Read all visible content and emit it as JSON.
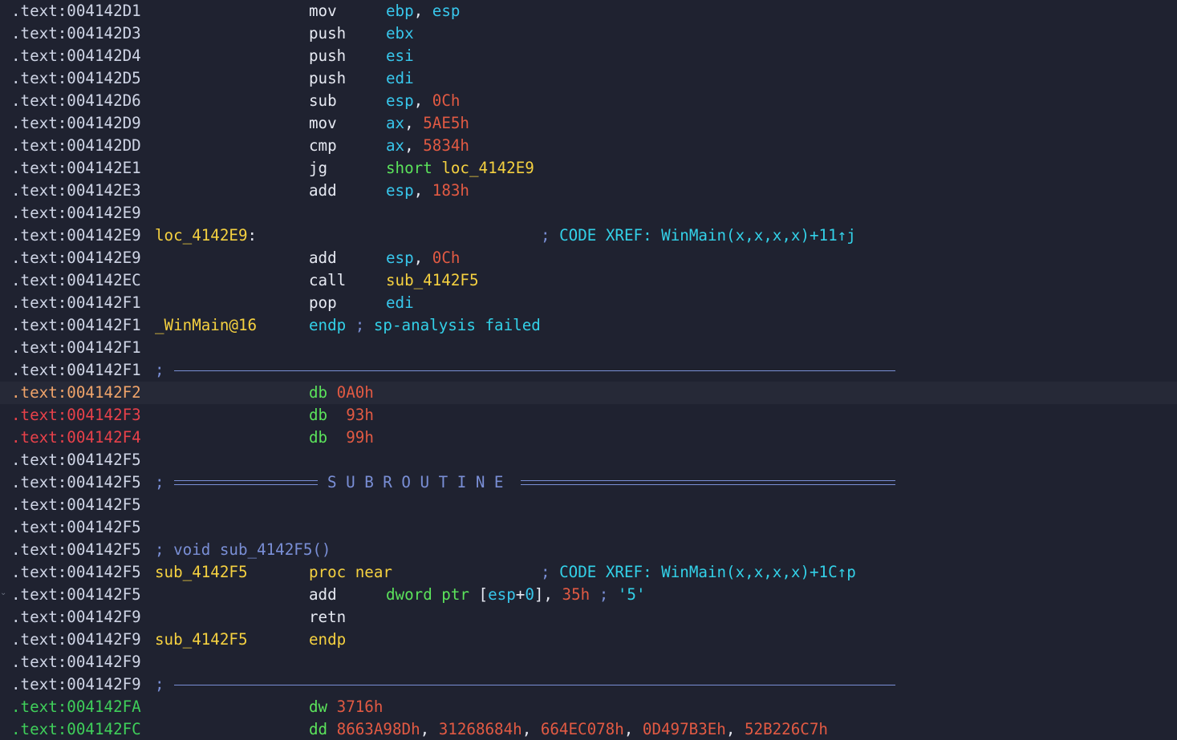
{
  "colors": {
    "background": "#1f2230",
    "highlight_row": "#262937",
    "address": "#cfd5e6",
    "address_orange": "#f0a46a",
    "address_red": "#e8414a",
    "address_green": "#3fcf5a",
    "mnemonic": "#e6e9f2",
    "register": "#38c7ec",
    "number": "#e25a43",
    "label": "#f5d140",
    "keyword_green": "#5be35b",
    "comment": "#7a8fd6",
    "xref_text": "#33d1e8",
    "separator": "#7a8fd6"
  },
  "icons": {
    "fold": "chevron-down-icon"
  },
  "subroutine_label": "S U B R O U T I N E",
  "semicolon": ";",
  "lines": [
    {
      "addr": ".text:004142D1",
      "mn": "mov",
      "op": [
        {
          "t": "ebp",
          "c": "register"
        },
        {
          "t": ", ",
          "c": "mnemonic"
        },
        {
          "t": "esp",
          "c": "register"
        }
      ]
    },
    {
      "addr": ".text:004142D3",
      "mn": "push",
      "op": [
        {
          "t": "ebx",
          "c": "register"
        }
      ]
    },
    {
      "addr": ".text:004142D4",
      "mn": "push",
      "op": [
        {
          "t": "esi",
          "c": "register"
        }
      ]
    },
    {
      "addr": ".text:004142D5",
      "mn": "push",
      "op": [
        {
          "t": "edi",
          "c": "register"
        }
      ]
    },
    {
      "addr": ".text:004142D6",
      "mn": "sub",
      "op": [
        {
          "t": "esp",
          "c": "register"
        },
        {
          "t": ", ",
          "c": "mnemonic"
        },
        {
          "t": "0Ch",
          "c": "number"
        }
      ]
    },
    {
      "addr": ".text:004142D9",
      "mn": "mov",
      "op": [
        {
          "t": "ax",
          "c": "register"
        },
        {
          "t": ", ",
          "c": "mnemonic"
        },
        {
          "t": "5AE5h",
          "c": "number"
        }
      ]
    },
    {
      "addr": ".text:004142DD",
      "mn": "cmp",
      "op": [
        {
          "t": "ax",
          "c": "register"
        },
        {
          "t": ", ",
          "c": "mnemonic"
        },
        {
          "t": "5834h",
          "c": "number"
        }
      ]
    },
    {
      "addr": ".text:004142E1",
      "mn": "jg",
      "op": [
        {
          "t": "short ",
          "c": "keyword_green"
        },
        {
          "t": "loc_4142E9",
          "c": "label"
        }
      ]
    },
    {
      "addr": ".text:004142E3",
      "mn": "add",
      "op": [
        {
          "t": "esp",
          "c": "register"
        },
        {
          "t": ", ",
          "c": "mnemonic"
        },
        {
          "t": "183h",
          "c": "number"
        }
      ]
    },
    {
      "addr": ".text:004142E9"
    },
    {
      "addr": ".text:004142E9",
      "name": [
        {
          "t": "loc_4142E9",
          "c": "label"
        },
        {
          "t": ":",
          "c": "mnemonic"
        }
      ],
      "xref": [
        {
          "t": "; ",
          "c": "comment"
        },
        {
          "t": "CODE XREF: WinMain(x,x,x,x)+11↑j",
          "c": "xref_text"
        }
      ]
    },
    {
      "addr": ".text:004142E9",
      "mn": "add",
      "op": [
        {
          "t": "esp",
          "c": "register"
        },
        {
          "t": ", ",
          "c": "mnemonic"
        },
        {
          "t": "0Ch",
          "c": "number"
        }
      ]
    },
    {
      "addr": ".text:004142EC",
      "mn": "call",
      "op": [
        {
          "t": "sub_4142F5",
          "c": "label"
        }
      ]
    },
    {
      "addr": ".text:004142F1",
      "mn": "pop",
      "op": [
        {
          "t": "edi",
          "c": "register"
        }
      ]
    },
    {
      "addr": ".text:004142F1",
      "name": [
        {
          "t": "_WinMain@16",
          "c": "label"
        }
      ],
      "mn_rich": [
        {
          "t": "endp ",
          "c": "xref_text"
        },
        {
          "t": "; ",
          "c": "comment"
        },
        {
          "t": "sp-analysis failed",
          "c": "xref_text"
        }
      ]
    },
    {
      "addr": ".text:004142F1"
    },
    {
      "addr": ".text:004142F1",
      "sep": "single"
    },
    {
      "addr": ".text:004142F2",
      "addr_c": "orange",
      "hl": true,
      "mn_rich": [
        {
          "t": "db ",
          "c": "keyword_green"
        },
        {
          "t": "0A0h",
          "c": "number"
        }
      ]
    },
    {
      "addr": ".text:004142F3",
      "addr_c": "red",
      "mn_rich": [
        {
          "t": "db  ",
          "c": "keyword_green"
        },
        {
          "t": "93h",
          "c": "number"
        }
      ]
    },
    {
      "addr": ".text:004142F4",
      "addr_c": "red",
      "mn_rich": [
        {
          "t": "db  ",
          "c": "keyword_green"
        },
        {
          "t": "99h",
          "c": "number"
        }
      ]
    },
    {
      "addr": ".text:004142F5"
    },
    {
      "addr": ".text:004142F5",
      "sep": "subroutine"
    },
    {
      "addr": ".text:004142F5"
    },
    {
      "addr": ".text:004142F5"
    },
    {
      "addr": ".text:004142F5",
      "name": [
        {
          "t": "; void sub_4142F5()",
          "c": "comment"
        }
      ]
    },
    {
      "addr": ".text:004142F5",
      "name": [
        {
          "t": "sub_4142F5",
          "c": "label"
        }
      ],
      "mn_rich": [
        {
          "t": "proc near",
          "c": "label"
        }
      ],
      "xref": [
        {
          "t": "; ",
          "c": "comment"
        },
        {
          "t": "CODE XREF: WinMain(x,x,x,x)+1C↑p",
          "c": "xref_text"
        }
      ]
    },
    {
      "addr": ".text:004142F5",
      "mn": "add",
      "op": [
        {
          "t": "dword ptr ",
          "c": "keyword_green"
        },
        {
          "t": "[",
          "c": "mnemonic"
        },
        {
          "t": "esp",
          "c": "register"
        },
        {
          "t": "+",
          "c": "mnemonic"
        },
        {
          "t": "0",
          "c": "register"
        },
        {
          "t": "], ",
          "c": "mnemonic"
        },
        {
          "t": "35h",
          "c": "number"
        },
        {
          "t": " ; ",
          "c": "comment"
        },
        {
          "t": "'5'",
          "c": "xref_text"
        }
      ]
    },
    {
      "addr": ".text:004142F9",
      "mn": "retn"
    },
    {
      "addr": ".text:004142F9",
      "name": [
        {
          "t": "sub_4142F5",
          "c": "label"
        }
      ],
      "mn_rich": [
        {
          "t": "endp",
          "c": "label"
        }
      ]
    },
    {
      "addr": ".text:004142F9"
    },
    {
      "addr": ".text:004142F9",
      "sep": "single"
    },
    {
      "addr": ".text:004142FA",
      "addr_c": "green",
      "mn_rich": [
        {
          "t": "dw ",
          "c": "keyword_green"
        },
        {
          "t": "3716h",
          "c": "number"
        }
      ]
    },
    {
      "addr": ".text:004142FC",
      "addr_c": "green",
      "mn_rich": [
        {
          "t": "dd ",
          "c": "keyword_green"
        },
        {
          "t": "8663A98Dh",
          "c": "number"
        },
        {
          "t": ", ",
          "c": "mnemonic"
        },
        {
          "t": "31268684h",
          "c": "number"
        },
        {
          "t": ", ",
          "c": "mnemonic"
        },
        {
          "t": "664EC078h",
          "c": "number"
        },
        {
          "t": ", ",
          "c": "mnemonic"
        },
        {
          "t": "0D497B3Eh",
          "c": "number"
        },
        {
          "t": ", ",
          "c": "mnemonic"
        },
        {
          "t": "52B226C7h",
          "c": "number"
        }
      ]
    }
  ]
}
